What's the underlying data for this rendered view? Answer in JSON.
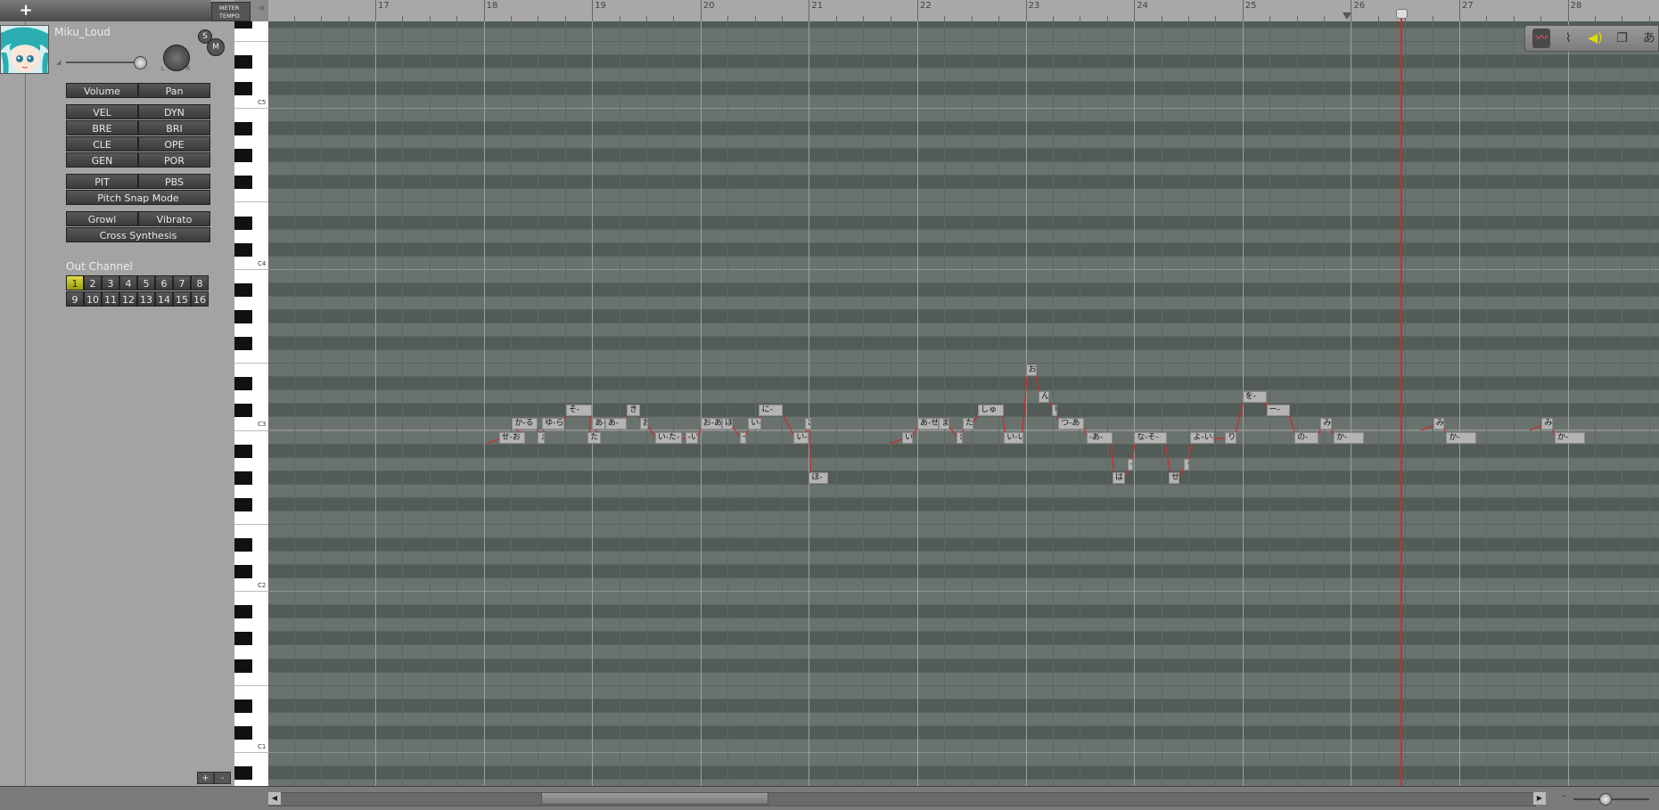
{
  "header": {
    "add_label": "+",
    "meter_label": "METER",
    "tempo_label": "TEMPO",
    "collapse_label": "«"
  },
  "track": {
    "singer_name": "Miku_Loud",
    "solo_label": "S",
    "mute_label": "M",
    "knob_left": "L",
    "knob_right": "R"
  },
  "params": {
    "row1": [
      "Volume",
      "Pan"
    ],
    "row2": [
      "VEL",
      "DYN"
    ],
    "row3": [
      "BRE",
      "BRI"
    ],
    "row4": [
      "CLE",
      "OPE"
    ],
    "row5": [
      "GEN",
      "POR"
    ],
    "row6": [
      "PIT",
      "PBS"
    ],
    "pitch_snap": "Pitch Snap Mode",
    "row8": [
      "Growl",
      "Vibrato"
    ],
    "cross_synthesis": "Cross Synthesis"
  },
  "out_channel": {
    "label": "Out Channel",
    "channels": [
      "1",
      "2",
      "3",
      "4",
      "5",
      "6",
      "7",
      "8",
      "9",
      "10",
      "11",
      "12",
      "13",
      "14",
      "15",
      "16"
    ],
    "selected": "1"
  },
  "keyboard": {
    "octave_labels": [
      "C5",
      "C4",
      "C3",
      "C2",
      "C1"
    ]
  },
  "ruler": {
    "measures": [
      "17",
      "18",
      "19",
      "20",
      "21",
      "22",
      "23",
      "24",
      "25",
      "26",
      "27",
      "28"
    ]
  },
  "notes": [
    {
      "lyric": "せ-お",
      "m": 18.14,
      "p": "B2",
      "len": 0.24
    },
    {
      "lyric": "か-る",
      "m": 18.26,
      "p": "C3",
      "len": 0.24
    },
    {
      "lyric": "え",
      "m": 18.5,
      "p": "B2",
      "len": 0.06
    },
    {
      "lyric": "ゆ-ら",
      "m": 18.54,
      "p": "C3",
      "len": 0.2
    },
    {
      "lyric": "そ-",
      "m": 18.76,
      "p": "C#3",
      "len": 0.24
    },
    {
      "lyric": "た",
      "m": 18.96,
      "p": "B2",
      "len": 0.12
    },
    {
      "lyric": "あ-",
      "m": 19.0,
      "p": "C3",
      "len": 0.12
    },
    {
      "lyric": "あ-",
      "m": 19.12,
      "p": "C3",
      "len": 0.2
    },
    {
      "lyric": "き",
      "m": 19.32,
      "p": "C#3",
      "len": 0.12
    },
    {
      "lyric": "お",
      "m": 19.44,
      "p": "C3",
      "len": 0.08
    },
    {
      "lyric": "い-た-",
      "m": 19.58,
      "p": "B2",
      "len": 0.25
    },
    {
      "lyric": "-い",
      "m": 19.86,
      "p": "B2",
      "len": 0.12
    },
    {
      "lyric": "お-あ-",
      "m": 20.0,
      "p": "C3",
      "len": 0.2
    },
    {
      "lyric": "ほ",
      "m": 20.2,
      "p": "C3",
      "len": 0.1
    },
    {
      "lyric": "ー",
      "m": 20.36,
      "p": "B2",
      "len": 0.06
    },
    {
      "lyric": "い-",
      "m": 20.44,
      "p": "C3",
      "len": 0.12
    },
    {
      "lyric": "に-",
      "m": 20.54,
      "p": "C#3",
      "len": 0.22
    },
    {
      "lyric": "い-",
      "m": 20.86,
      "p": "B2",
      "len": 0.14
    },
    {
      "lyric": "さ",
      "m": 20.96,
      "p": "C3",
      "len": 0.06
    },
    {
      "lyric": "ほ-",
      "m": 21.0,
      "p": "G#2",
      "len": 0.18
    },
    {
      "lyric": "い-",
      "m": 21.86,
      "p": "B2",
      "len": 0.1
    },
    {
      "lyric": "あ-せ-",
      "m": 22.0,
      "p": "C3",
      "len": 0.2
    },
    {
      "lyric": "ま",
      "m": 22.2,
      "p": "C3",
      "len": 0.1
    },
    {
      "lyric": "き",
      "m": 22.36,
      "p": "B2",
      "len": 0.06
    },
    {
      "lyric": "た",
      "m": 22.42,
      "p": "C3",
      "len": 0.1
    },
    {
      "lyric": "しゅ",
      "m": 22.56,
      "p": "C#3",
      "len": 0.24
    },
    {
      "lyric": "い-い",
      "m": 22.8,
      "p": "B2",
      "len": 0.18
    },
    {
      "lyric": "お",
      "m": 23.0,
      "p": "E3",
      "len": 0.1
    },
    {
      "lyric": "ん",
      "m": 23.12,
      "p": "D3",
      "len": 0.1
    },
    {
      "lyric": "い",
      "m": 23.24,
      "p": "C#3",
      "len": 0.04
    },
    {
      "lyric": "つ-あ",
      "m": 23.3,
      "p": "C3",
      "len": 0.24
    },
    {
      "lyric": "-あ-",
      "m": 23.56,
      "p": "B2",
      "len": 0.24
    },
    {
      "lyric": "は",
      "m": 23.8,
      "p": "G#2",
      "len": 0.12
    },
    {
      "lyric": "-",
      "m": 23.94,
      "p": "A2",
      "len": 0.04
    },
    {
      "lyric": "な-そ-",
      "m": 24.0,
      "p": "B2",
      "len": 0.3
    },
    {
      "lyric": "せ",
      "m": 24.32,
      "p": "G#2",
      "len": 0.1
    },
    {
      "lyric": "ー",
      "m": 24.46,
      "p": "A2",
      "len": 0.04
    },
    {
      "lyric": "よ-い-お",
      "m": 24.52,
      "p": "B2",
      "len": 0.22
    },
    {
      "lyric": "り",
      "m": 24.84,
      "p": "B2",
      "len": 0.1
    },
    {
      "lyric": "を-",
      "m": 25.0,
      "p": "D3",
      "len": 0.22
    },
    {
      "lyric": "ー-",
      "m": 25.22,
      "p": "C#3",
      "len": 0.22
    },
    {
      "lyric": "の-",
      "m": 25.48,
      "p": "B2",
      "len": 0.22
    },
    {
      "lyric": "み",
      "m": 25.72,
      "p": "C3",
      "len": 0.1
    },
    {
      "lyric": "か-",
      "m": 25.84,
      "p": "B2",
      "len": 0.28
    },
    {
      "lyric": "み",
      "m": 26.76,
      "p": "C3",
      "len": 0.1
    },
    {
      "lyric": "か-",
      "m": 26.88,
      "p": "B2",
      "len": 0.28
    },
    {
      "lyric": "み",
      "m": 27.76,
      "p": "C3",
      "len": 0.1
    },
    {
      "lyric": "か-",
      "m": 27.88,
      "p": "B2",
      "len": 0.28
    }
  ],
  "playhead_measure": 26.46,
  "colors": {
    "playhead": "#d42a2a",
    "pitch_line": "#c23030",
    "selected_channel": "#d8d838"
  },
  "tools": [
    "pitch-curve-tool-icon",
    "pitch-snap-tool-icon",
    "speaker-icon",
    "copy-icon",
    "translate-icon"
  ]
}
